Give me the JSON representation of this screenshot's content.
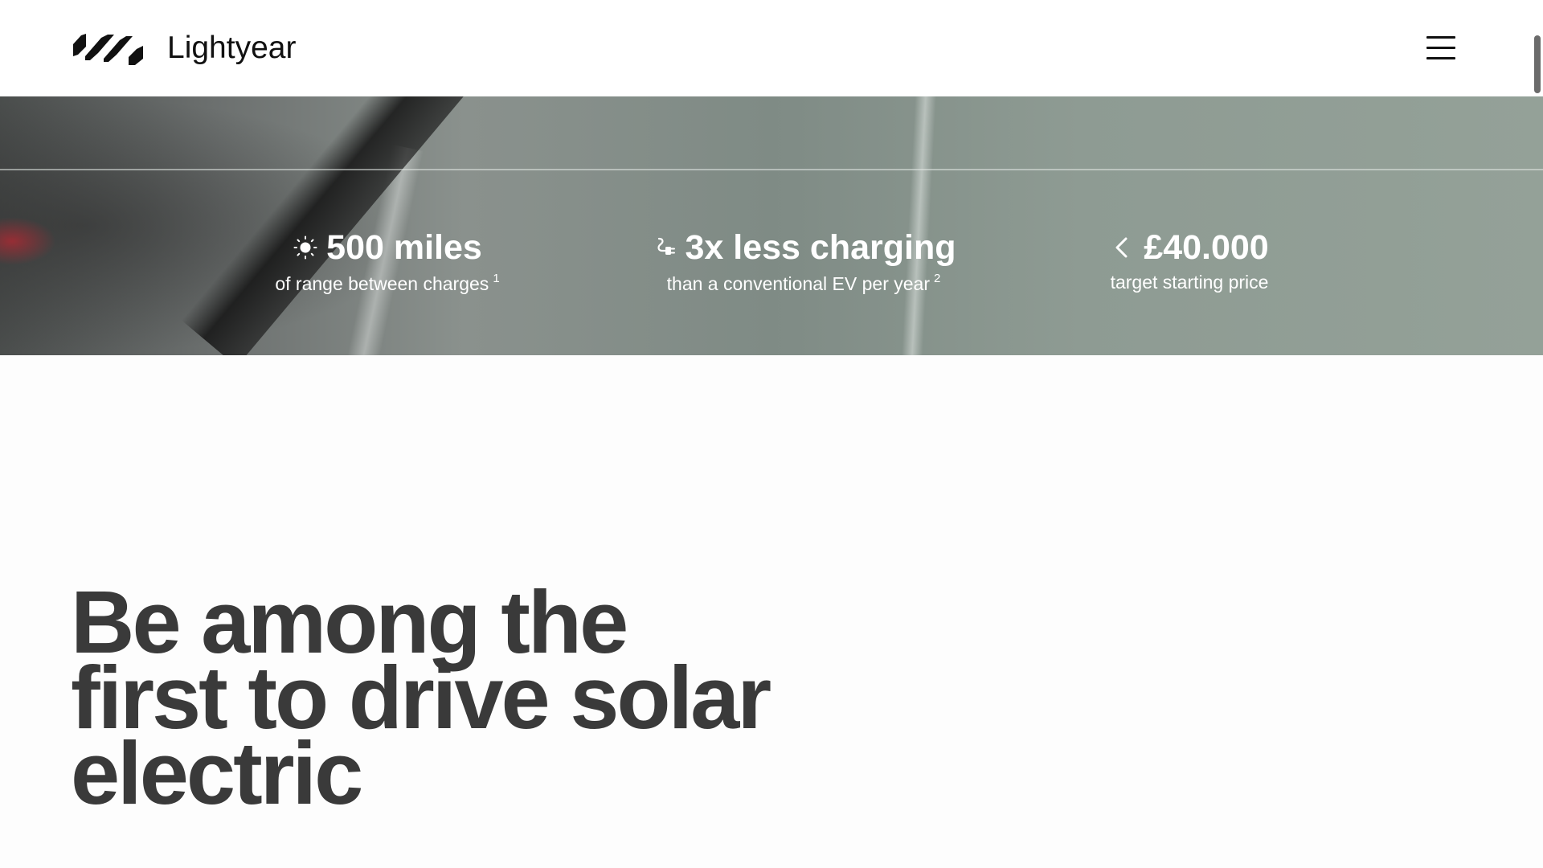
{
  "header": {
    "logo_text": "Lightyear",
    "logo_icon": "lightyear-logo-icon",
    "menu_icon": "hamburger-menu-icon"
  },
  "hero": {
    "stats": [
      {
        "icon": "sun-icon",
        "value": "500 miles",
        "caption": "of range between charges",
        "footnote": "1"
      },
      {
        "icon": "charging-plug-icon",
        "value": "3x less charging",
        "caption": "than a conventional EV per year",
        "footnote": "2"
      },
      {
        "icon": "chevron-left-icon",
        "value": "£40.000",
        "caption": "target starting price",
        "footnote": ""
      }
    ]
  },
  "main": {
    "headline_lines": [
      "Be among the",
      "first to drive solar",
      "electric"
    ]
  },
  "colors": {
    "header_bg": "#ffffff",
    "page_bg": "#fdfdfd",
    "headline_text": "#3a3a3a",
    "stat_text": "#ffffff",
    "logo": "#111111"
  }
}
